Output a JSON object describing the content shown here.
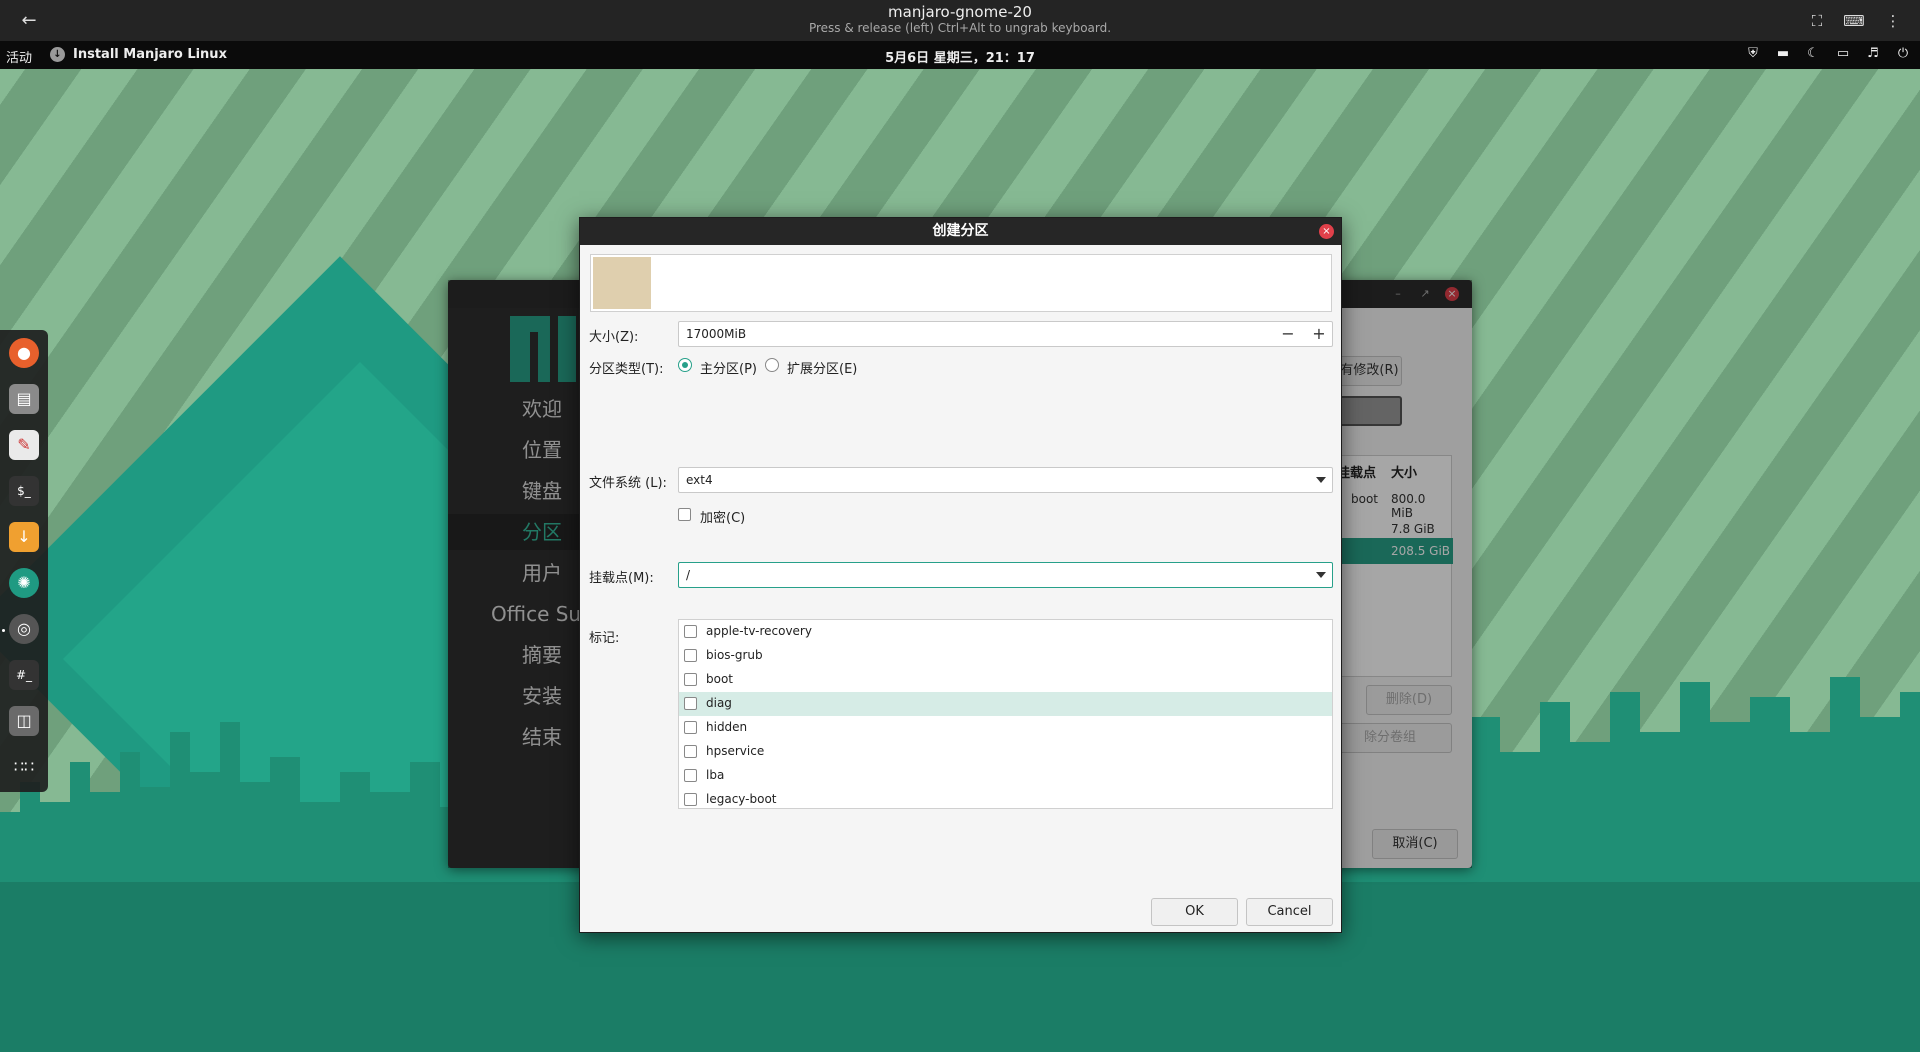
{
  "viewer": {
    "title": "manjaro-gnome-20",
    "subtitle": "Press & release (left) Ctrl+Alt to ungrab keyboard."
  },
  "topbar": {
    "activities": "活动",
    "app_name": "Install Manjaro Linux",
    "clock": "5月6日 星期三，21：17"
  },
  "installer": {
    "steps": [
      "欢迎",
      "位置",
      "键盘",
      "分区",
      "用户",
      "Office Suite",
      "摘要",
      "安装",
      "结束"
    ],
    "current_step": "分区",
    "revert_button": "撤销所有修改(R)",
    "table_headers": [
      "挂载点",
      "大小"
    ],
    "rows": [
      {
        "mount": "boot",
        "size": "800.0 MiB"
      },
      {
        "mount": "",
        "size": "7.8 GiB"
      },
      {
        "mount": "",
        "size": "208.5 GiB"
      }
    ],
    "delete_button": "删除(D)",
    "lvm_button": "除分卷组",
    "cancel_button": "取消(C)"
  },
  "dialog": {
    "title": "创建分区",
    "size_label": "大小(Z):",
    "size_value": "17000MiB",
    "type_label": "分区类型(T):",
    "primary_label": "主分区(P)",
    "extended_label": "扩展分区(E)",
    "fs_label": "文件系统 (L):",
    "fs_value": "ext4",
    "encrypt_label": "加密(C)",
    "mount_label": "挂载点(M):",
    "mount_value": "/",
    "flags_label": "标记:",
    "flags": [
      "apple-tv-recovery",
      "bios-grub",
      "boot",
      "diag",
      "hidden",
      "hpservice",
      "lba",
      "legacy-boot"
    ],
    "highlighted_flag": "diag",
    "ok": "OK",
    "cancel": "Cancel"
  },
  "colors": {
    "accent": "#27a08a",
    "swatch": "#dfcfae"
  }
}
